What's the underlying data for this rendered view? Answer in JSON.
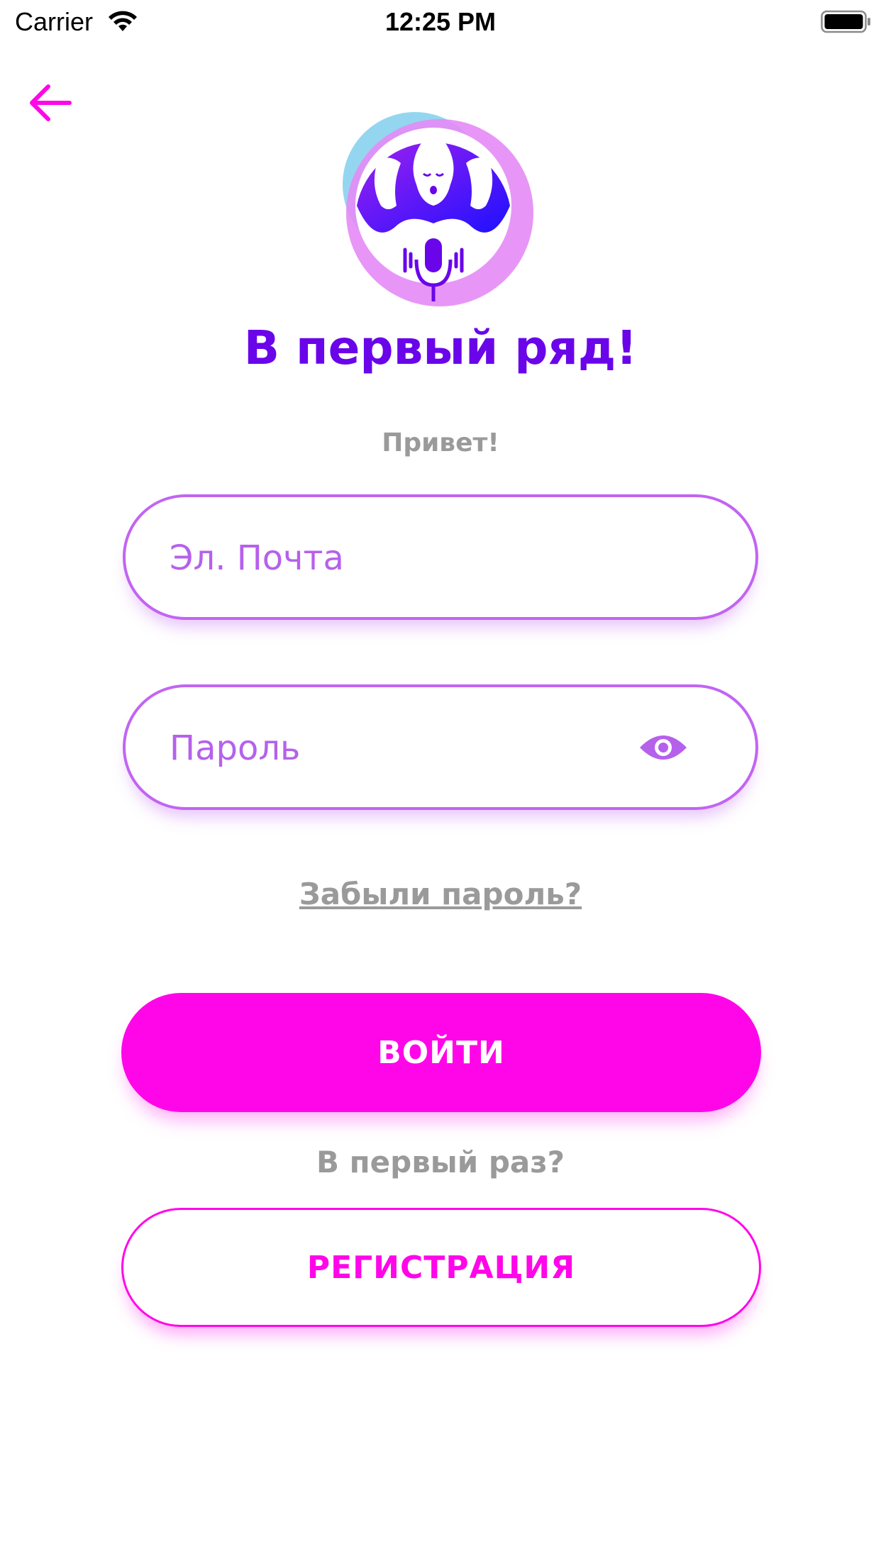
{
  "status_bar": {
    "carrier": "Carrier",
    "time": "12:25 PM"
  },
  "header": {
    "back_icon": "arrow-left-icon"
  },
  "logo": {
    "icon": "three-singers-microphone-logo"
  },
  "app": {
    "title": "В первый ряд!",
    "greeting": "Привет!"
  },
  "form": {
    "email_placeholder": "Эл. Почта",
    "password_placeholder": "Пароль",
    "password_toggle_icon": "eye-icon",
    "forgot_password": "Забыли пароль?",
    "login_label": "ВОЙТИ",
    "first_time": "В первый раз?",
    "register_label": "РЕГИСТРАЦИЯ"
  },
  "colors": {
    "title": "#6a05ea",
    "accent": "#ff06e9",
    "field_border": "#c264f3",
    "muted_text": "#9a9a9a"
  }
}
